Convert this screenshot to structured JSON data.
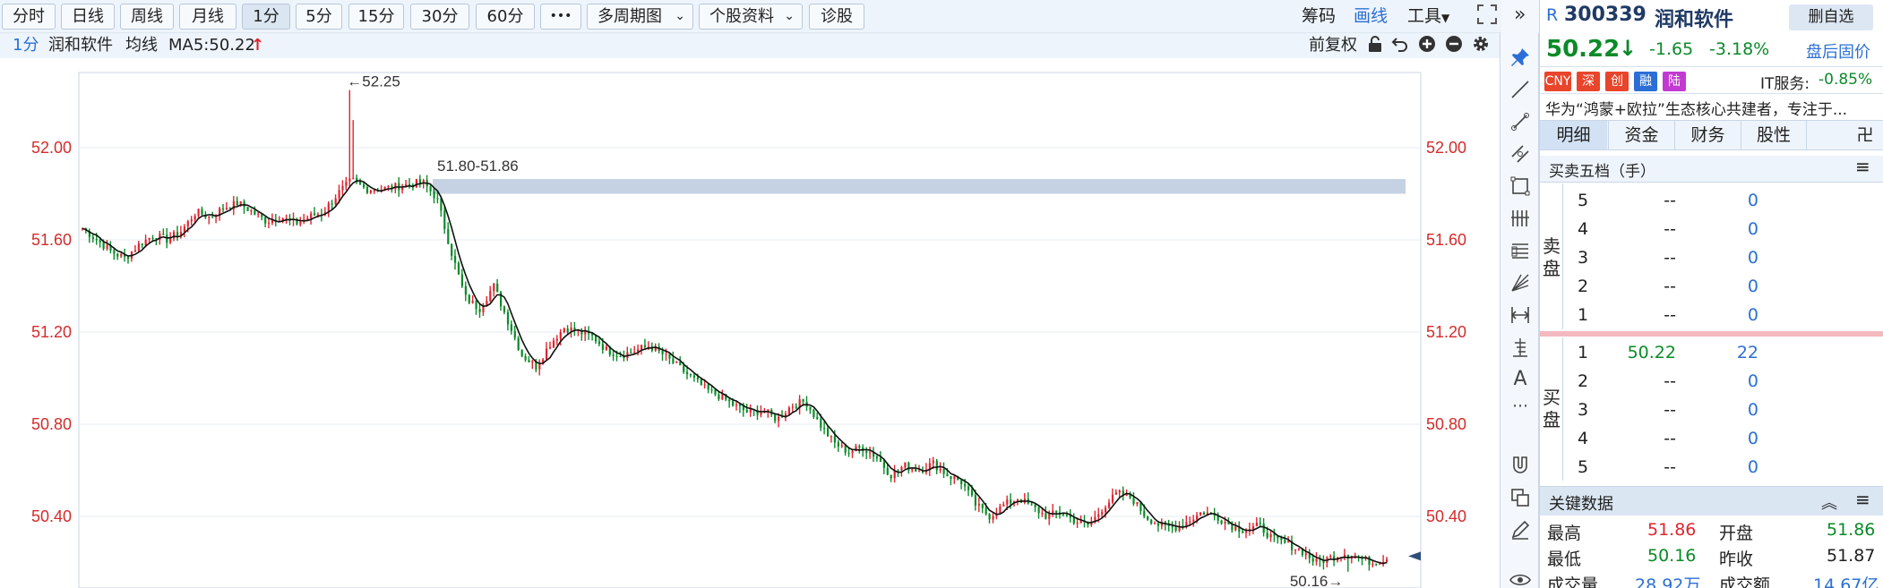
{
  "toolbar": {
    "periods": [
      "分时",
      "日线",
      "周线",
      "月线",
      "1分",
      "5分",
      "15分",
      "30分",
      "60分"
    ],
    "active_period": "1分",
    "more": "•••",
    "multi_period": "多周期图",
    "stock_info": "个股资料",
    "diagnose": "诊股",
    "chips": "筹码",
    "draw": "画线",
    "tools": "工具",
    "fullscreen_icon": "fullscreen-icon",
    "collapse_icon": "double-chevron-right-icon"
  },
  "info_row": {
    "period": "1分",
    "stock_name": "润和软件",
    "avg_line": "均线",
    "ma_label": "MA5:50.22",
    "ma_arrow": "↑",
    "adjust": "前复权"
  },
  "chart_data": {
    "type": "candlestick",
    "y_ticks": [
      "52.00",
      "51.60",
      "51.20",
      "50.80",
      "50.40"
    ],
    "y_tick_values": [
      52.0,
      51.6,
      51.2,
      50.8,
      50.4
    ],
    "ylim": [
      50.16,
      52.35
    ],
    "high_label": "←52.25",
    "high_value": 52.25,
    "low_label": "50.16→",
    "low_value": 50.16,
    "zone_label": "51.80-51.86",
    "zone": [
      51.8,
      51.86
    ],
    "up_color": "#e0242e",
    "down_color": "#0b8a28",
    "ma_color": "#111111",
    "series_anchor_prices": [
      51.65,
      51.6,
      51.55,
      51.52,
      51.58,
      51.62,
      51.6,
      51.64,
      51.72,
      51.7,
      51.74,
      51.76,
      51.72,
      51.68,
      51.7,
      51.67,
      51.7,
      51.72,
      51.8,
      51.86,
      51.82,
      51.82,
      51.83,
      51.84,
      51.85,
      51.78,
      51.55,
      51.35,
      51.3,
      51.4,
      51.25,
      51.1,
      51.05,
      51.15,
      51.22,
      51.2,
      51.18,
      51.12,
      51.1,
      51.12,
      51.14,
      51.1,
      51.05,
      51.0,
      50.95,
      50.92,
      50.88,
      50.85,
      50.86,
      50.82,
      50.88,
      50.9,
      50.8,
      50.72,
      50.68,
      50.7,
      50.66,
      50.58,
      50.62,
      50.6,
      50.63,
      50.58,
      50.55,
      50.45,
      50.4,
      50.45,
      50.48,
      50.44,
      50.4,
      50.42,
      50.38,
      50.36,
      50.44,
      50.5,
      50.48,
      50.4,
      50.36,
      50.35,
      50.38,
      50.42,
      50.4,
      50.36,
      50.34,
      50.36,
      50.3,
      50.28,
      50.25,
      50.2,
      50.22,
      50.24,
      50.22,
      50.2,
      50.22
    ]
  },
  "panel": {
    "prefix": "R",
    "code": "300339",
    "name": "润和软件",
    "remove_watch": "删自选",
    "price": "50.22",
    "price_arrow": "↓",
    "change": "-1.65",
    "change_pct": "-3.18%",
    "after_hours": "盘后固价",
    "badges": [
      {
        "text": "CNY",
        "color": "#e8452b"
      },
      {
        "text": "深",
        "color": "#e8452b"
      },
      {
        "text": "创",
        "color": "#e8452b"
      },
      {
        "text": "融",
        "color": "#2b6fd6"
      },
      {
        "text": "陆",
        "color": "#c23ad1"
      }
    ],
    "sector": "IT服务:",
    "sector_change": "-0.85%",
    "news": "华为“鸿蒙+欧拉”生态核心共建者，专注于...",
    "tabs": [
      "明细",
      "资金",
      "财务",
      "股性"
    ],
    "tab_more": "卍",
    "order_book_title": "买卖五档（手）",
    "sell_label": "卖盘",
    "buy_label": "买盘",
    "sell": [
      {
        "level": "5",
        "price": "--",
        "vol": "0"
      },
      {
        "level": "4",
        "price": "--",
        "vol": "0"
      },
      {
        "level": "3",
        "price": "--",
        "vol": "0"
      },
      {
        "level": "2",
        "price": "--",
        "vol": "0"
      },
      {
        "level": "1",
        "price": "--",
        "vol": "0"
      }
    ],
    "buy": [
      {
        "level": "1",
        "price": "50.22",
        "vol": "22"
      },
      {
        "level": "2",
        "price": "--",
        "vol": "0"
      },
      {
        "level": "3",
        "price": "--",
        "vol": "0"
      },
      {
        "level": "4",
        "price": "--",
        "vol": "0"
      },
      {
        "level": "5",
        "price": "--",
        "vol": "0"
      }
    ],
    "key_data_title": "关键数据",
    "key": {
      "high_label": "最高",
      "high": "51.86",
      "open_label": "开盘",
      "open": "51.86",
      "low_label": "最低",
      "low": "50.16",
      "prev_close_label": "昨收",
      "prev_close": "51.87",
      "volume_label": "成交量",
      "volume": "28.92万",
      "amount_label": "成交额",
      "amount": "14.67亿"
    }
  }
}
